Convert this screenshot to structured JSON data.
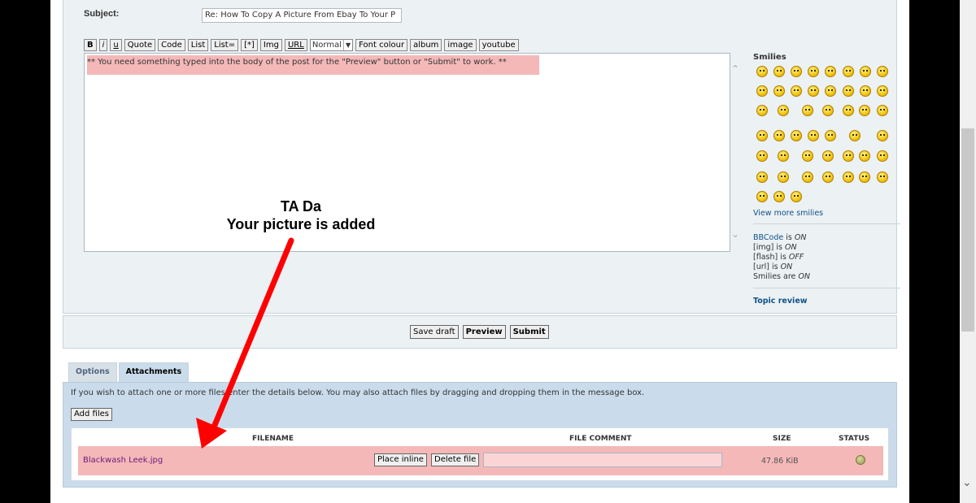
{
  "subject": {
    "label": "Subject:",
    "value": "Re: How To Copy A Picture From Ebay To Your P"
  },
  "bbcode": {
    "buttons": [
      "B",
      "i",
      "u",
      "Quote",
      "Code",
      "List",
      "List=",
      "[*]",
      "Img",
      "URL"
    ],
    "size_select": "Normal",
    "buttons2": [
      "Font colour",
      "album",
      "image",
      "youtube"
    ]
  },
  "message": {
    "text": "** You need something typed into the body of the post for the \"Preview\" button or \"Submit\" to work. **"
  },
  "sidebar": {
    "smilies_title": "Smilies",
    "view_more": "View more smilies",
    "options": [
      {
        "label": "BBCode",
        "mid": " is ",
        "state": "ON"
      },
      {
        "label": "[img]",
        "mid": " is ",
        "state": "ON"
      },
      {
        "label": "[flash]",
        "mid": " is ",
        "state": "OFF"
      },
      {
        "label": "[url]",
        "mid": " is ",
        "state": "ON"
      },
      {
        "label": "Smilies",
        "mid": " are ",
        "state": "ON"
      }
    ],
    "topic_review": "Topic review"
  },
  "submit_buttons": {
    "save_draft": "Save draft",
    "preview": "Preview",
    "submit": "Submit"
  },
  "tabs": [
    {
      "label": "Options",
      "active": false
    },
    {
      "label": "Attachments",
      "active": true
    }
  ],
  "attachments": {
    "help": "If you wish to attach one or more files enter the details below. You may also attach files by dragging and dropping them in the message box.",
    "add_files": "Add files",
    "columns": [
      "FILENAME",
      "FILE COMMENT",
      "SIZE",
      "STATUS"
    ],
    "file": {
      "name": "Blackwash Leek.jpg",
      "place_inline": "Place inline",
      "delete_file": "Delete file",
      "comment": "",
      "size": "47.86 KiB"
    }
  },
  "annotation": {
    "line1": "TA Da",
    "line2": "Your picture is added",
    "color": "#ff0000"
  },
  "colors": {
    "highlight": "#f4b8b8",
    "panel_bg": "#ecf1f3",
    "attach_bg": "#cadceb",
    "link": "#105289"
  }
}
